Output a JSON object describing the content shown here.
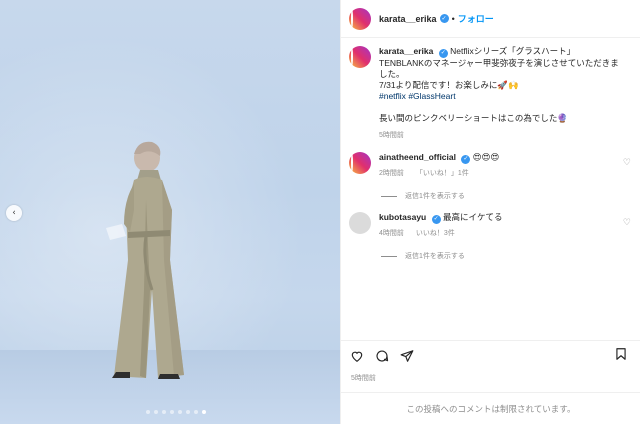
{
  "post": {
    "author": "karata__erika",
    "follow_label": "フォロー",
    "separator": "•"
  },
  "caption": {
    "username": "karata__erika",
    "line1": "Netflixシリーズ「グラスハート」",
    "line2": "TENBLANKのマネージャー甲斐弥夜子を演じさせていただきました。",
    "line3": "7/31より配信です！お楽しみに🚀🙌",
    "hashtag1": "#netflix",
    "hashtag2": "#GlassHeart",
    "line4": "長い間のピンクベリーショートはこの為でした🔮",
    "time": "5時間前"
  },
  "comments": [
    {
      "username": "ainatheend_official",
      "text": "😍😍😍",
      "time": "2時間前",
      "likes": "「いいね！」1件",
      "replies": "返信1件を表示する"
    },
    {
      "username": "kubotasayu",
      "text": "最高にイケてる",
      "time": "4時間前",
      "likes": "いいね！3件",
      "replies": "返信1件を表示する"
    }
  ],
  "footer": {
    "posted_time": "5時間前",
    "comments_restricted": "この投稿へのコメントは制限されています。"
  },
  "carousel": {
    "prev_icon": "‹",
    "dot_count": 8,
    "active_dot": 8
  },
  "icons": {
    "verified": "✓",
    "heart": "♡"
  }
}
